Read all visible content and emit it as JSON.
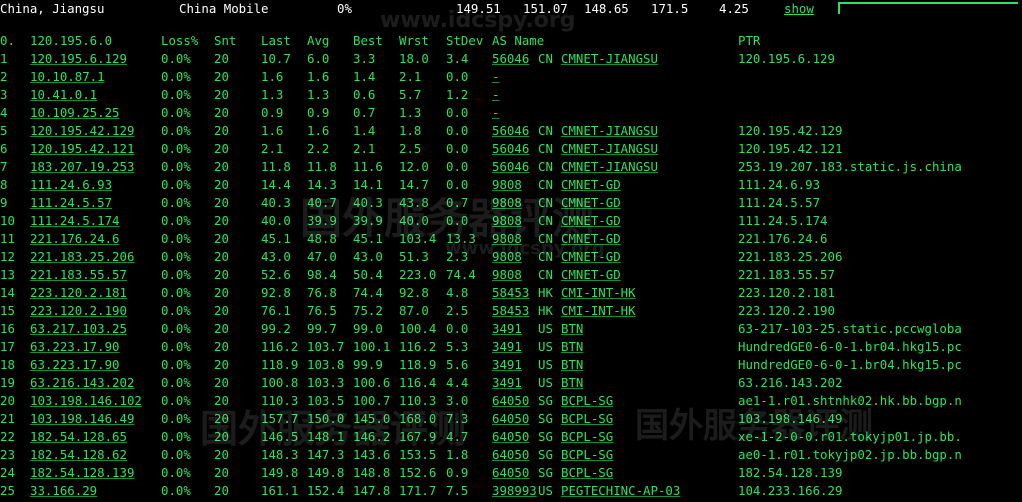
{
  "topbar": {
    "location": "China, Jiangsu",
    "isp": "China Mobile",
    "loss": "0%",
    "v1": "149.51",
    "v2": "151.07",
    "v3": "148.65",
    "v4": "171.5",
    "v5": "4.25",
    "show": "show"
  },
  "watermark": {
    "site": "www.idcspy.org",
    "cn": "国外服务器评测"
  },
  "header": {
    "hop": "0.",
    "host": "120.195.6.0",
    "loss": "Loss%",
    "snt": "Snt",
    "last": "Last",
    "avg": "Avg",
    "best": "Best",
    "wrst": "Wrst",
    "stdev": "StDev",
    "as": "AS Name",
    "ptr": "PTR"
  },
  "hops": [
    {
      "hop": "1",
      "host": "120.195.6.129",
      "loss": "0.0%",
      "snt": "20",
      "last": "10.7",
      "avg": "6.0",
      "best": "3.3",
      "wrst": "18.0",
      "stdev": "3.4",
      "asn": "56046",
      "cc": "CN",
      "asname": "CMNET-JIANGSU",
      "ptr": "120.195.6.129"
    },
    {
      "hop": "2",
      "host": "10.10.87.1",
      "loss": "0.0%",
      "snt": "20",
      "last": "1.6",
      "avg": "1.6",
      "best": "1.4",
      "wrst": "2.1",
      "stdev": "0.0",
      "asn": "",
      "cc": "",
      "asname": "-",
      "ptr": ""
    },
    {
      "hop": "3",
      "host": "10.41.0.1",
      "loss": "0.0%",
      "snt": "20",
      "last": "1.3",
      "avg": "1.3",
      "best": "0.6",
      "wrst": "5.7",
      "stdev": "1.2",
      "asn": "",
      "cc": "",
      "asname": "-",
      "ptr": ""
    },
    {
      "hop": "4",
      "host": "10.109.25.25",
      "loss": "0.0%",
      "snt": "20",
      "last": "0.9",
      "avg": "0.9",
      "best": "0.7",
      "wrst": "1.3",
      "stdev": "0.0",
      "asn": "",
      "cc": "",
      "asname": "-",
      "ptr": ""
    },
    {
      "hop": "5",
      "host": "120.195.42.129",
      "loss": "0.0%",
      "snt": "20",
      "last": "1.6",
      "avg": "1.6",
      "best": "1.4",
      "wrst": "1.8",
      "stdev": "0.0",
      "asn": "56046",
      "cc": "CN",
      "asname": "CMNET-JIANGSU",
      "ptr": "120.195.42.129"
    },
    {
      "hop": "6",
      "host": "120.195.42.121",
      "loss": "0.0%",
      "snt": "20",
      "last": "2.1",
      "avg": "2.2",
      "best": "2.1",
      "wrst": "2.5",
      "stdev": "0.0",
      "asn": "56046",
      "cc": "CN",
      "asname": "CMNET-JIANGSU",
      "ptr": "120.195.42.121"
    },
    {
      "hop": "7",
      "host": "183.207.19.253",
      "loss": "0.0%",
      "snt": "20",
      "last": "11.8",
      "avg": "11.8",
      "best": "11.6",
      "wrst": "12.0",
      "stdev": "0.0",
      "asn": "56046",
      "cc": "CN",
      "asname": "CMNET-JIANGSU",
      "ptr": "253.19.207.183.static.js.china"
    },
    {
      "hop": "8",
      "host": "111.24.6.93",
      "loss": "0.0%",
      "snt": "20",
      "last": "14.4",
      "avg": "14.3",
      "best": "14.1",
      "wrst": "14.7",
      "stdev": "0.0",
      "asn": "9808",
      "cc": "CN",
      "asname": "CMNET-GD",
      "ptr": "111.24.6.93"
    },
    {
      "hop": "9",
      "host": "111.24.5.57",
      "loss": "0.0%",
      "snt": "20",
      "last": "40.3",
      "avg": "40.7",
      "best": "40.3",
      "wrst": "43.8",
      "stdev": "0.7",
      "asn": "9808",
      "cc": "CN",
      "asname": "CMNET-GD",
      "ptr": "111.24.5.57"
    },
    {
      "hop": "10",
      "host": "111.24.5.174",
      "loss": "0.0%",
      "snt": "20",
      "last": "40.0",
      "avg": "39.9",
      "best": "39.9",
      "wrst": "40.0",
      "stdev": "0.0",
      "asn": "9808",
      "cc": "CN",
      "asname": "CMNET-GD",
      "ptr": "111.24.5.174"
    },
    {
      "hop": "11",
      "host": "221.176.24.6",
      "loss": "0.0%",
      "snt": "20",
      "last": "45.1",
      "avg": "48.8",
      "best": "45.1",
      "wrst": "103.4",
      "stdev": "13.3",
      "asn": "9808",
      "cc": "CN",
      "asname": "CMNET-GD",
      "ptr": "221.176.24.6"
    },
    {
      "hop": "12",
      "host": "221.183.25.206",
      "loss": "0.0%",
      "snt": "20",
      "last": "43.0",
      "avg": "47.0",
      "best": "43.0",
      "wrst": "51.3",
      "stdev": "2.3",
      "asn": "9808",
      "cc": "CN",
      "asname": "CMNET-GD",
      "ptr": "221.183.25.206"
    },
    {
      "hop": "13",
      "host": "221.183.55.57",
      "loss": "0.0%",
      "snt": "20",
      "last": "52.6",
      "avg": "98.4",
      "best": "50.4",
      "wrst": "223.0",
      "stdev": "74.4",
      "asn": "9808",
      "cc": "CN",
      "asname": "CMNET-GD",
      "ptr": "221.183.55.57"
    },
    {
      "hop": "14",
      "host": "223.120.2.181",
      "loss": "0.0%",
      "snt": "20",
      "last": "92.8",
      "avg": "76.8",
      "best": "74.4",
      "wrst": "92.8",
      "stdev": "4.8",
      "asn": "58453",
      "cc": "HK",
      "asname": "CMI-INT-HK",
      "ptr": "223.120.2.181"
    },
    {
      "hop": "15",
      "host": "223.120.2.190",
      "loss": "0.0%",
      "snt": "20",
      "last": "76.1",
      "avg": "76.5",
      "best": "75.2",
      "wrst": "87.0",
      "stdev": "2.5",
      "asn": "58453",
      "cc": "HK",
      "asname": "CMI-INT-HK",
      "ptr": "223.120.2.190"
    },
    {
      "hop": "16",
      "host": "63.217.103.25",
      "loss": "0.0%",
      "snt": "20",
      "last": "99.2",
      "avg": "99.7",
      "best": "99.0",
      "wrst": "100.4",
      "stdev": "0.0",
      "asn": "3491",
      "cc": "US",
      "asname": "BTN",
      "ptr": "63-217-103-25.static.pccwgloba"
    },
    {
      "hop": "17",
      "host": "63.223.17.90",
      "loss": "0.0%",
      "snt": "20",
      "last": "116.2",
      "avg": "103.7",
      "best": "100.1",
      "wrst": "116.2",
      "stdev": "5.3",
      "asn": "3491",
      "cc": "US",
      "asname": "BTN",
      "ptr": "HundredGE0-6-0-1.br04.hkg15.pc"
    },
    {
      "hop": "18",
      "host": "63.223.17.90",
      "loss": "0.0%",
      "snt": "20",
      "last": "118.9",
      "avg": "103.8",
      "best": "99.9",
      "wrst": "118.9",
      "stdev": "5.6",
      "asn": "3491",
      "cc": "US",
      "asname": "BTN",
      "ptr": "HundredGE0-6-0-1.br04.hkg15.pc"
    },
    {
      "hop": "19",
      "host": "63.216.143.202",
      "loss": "0.0%",
      "snt": "20",
      "last": "100.8",
      "avg": "103.3",
      "best": "100.6",
      "wrst": "116.4",
      "stdev": "4.4",
      "asn": "3491",
      "cc": "US",
      "asname": "BTN",
      "ptr": "63.216.143.202"
    },
    {
      "hop": "20",
      "host": "103.198.146.102",
      "loss": "0.0%",
      "snt": "20",
      "last": "110.3",
      "avg": "103.5",
      "best": "100.7",
      "wrst": "110.3",
      "stdev": "3.0",
      "asn": "64050",
      "cc": "SG",
      "asname": "BCPL-SG",
      "ptr": "ae1-1.r01.shtnhk02.hk.bb.bgp.n"
    },
    {
      "hop": "21",
      "host": "103.198.146.49",
      "loss": "0.0%",
      "snt": "20",
      "last": "157.7",
      "avg": "150.0",
      "best": "145.0",
      "wrst": "168.0",
      "stdev": "7.3",
      "asn": "64050",
      "cc": "SG",
      "asname": "BCPL-SG",
      "ptr": "103.198.146.49"
    },
    {
      "hop": "22",
      "host": "182.54.128.65",
      "loss": "0.0%",
      "snt": "20",
      "last": "146.5",
      "avg": "148.1",
      "best": "146.2",
      "wrst": "167.9",
      "stdev": "4.7",
      "asn": "64050",
      "cc": "SG",
      "asname": "BCPL-SG",
      "ptr": "xe-1-2-0-0.r01.tokyjp01.jp.bb."
    },
    {
      "hop": "23",
      "host": "182.54.128.62",
      "loss": "0.0%",
      "snt": "20",
      "last": "148.3",
      "avg": "147.3",
      "best": "143.6",
      "wrst": "153.5",
      "stdev": "1.8",
      "asn": "64050",
      "cc": "SG",
      "asname": "BCPL-SG",
      "ptr": "ae0-1.r01.tokyjp02.jp.bb.bgp.n"
    },
    {
      "hop": "24",
      "host": "182.54.128.139",
      "loss": "0.0%",
      "snt": "20",
      "last": "149.8",
      "avg": "149.8",
      "best": "148.8",
      "wrst": "152.6",
      "stdev": "0.9",
      "asn": "64050",
      "cc": "SG",
      "asname": "BCPL-SG",
      "ptr": "182.54.128.139"
    },
    {
      "hop": "25",
      "host": "33.166.29",
      "loss": "0.0%",
      "snt": "20",
      "last": "161.1",
      "avg": "152.4",
      "best": "147.8",
      "wrst": "171.7",
      "stdev": "7.5",
      "asn": "398993",
      "cc": "US",
      "asname": "PEGTECHINC-AP-03",
      "ptr": "104.233.166.29"
    }
  ]
}
